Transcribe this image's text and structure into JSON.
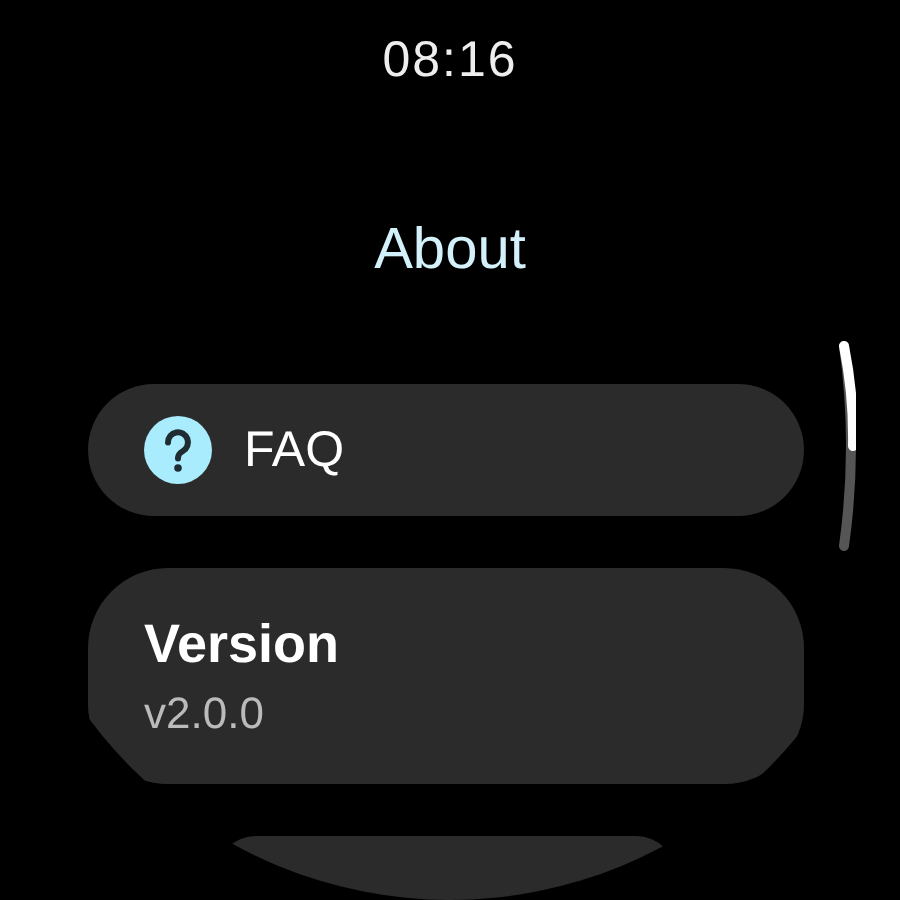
{
  "status_bar": {
    "time": "08:16"
  },
  "title": "About",
  "items": [
    {
      "kind": "chip",
      "label": "FAQ"
    },
    {
      "kind": "card",
      "label": "Version",
      "value": "v2.0.0"
    },
    {
      "kind": "empty"
    }
  ]
}
